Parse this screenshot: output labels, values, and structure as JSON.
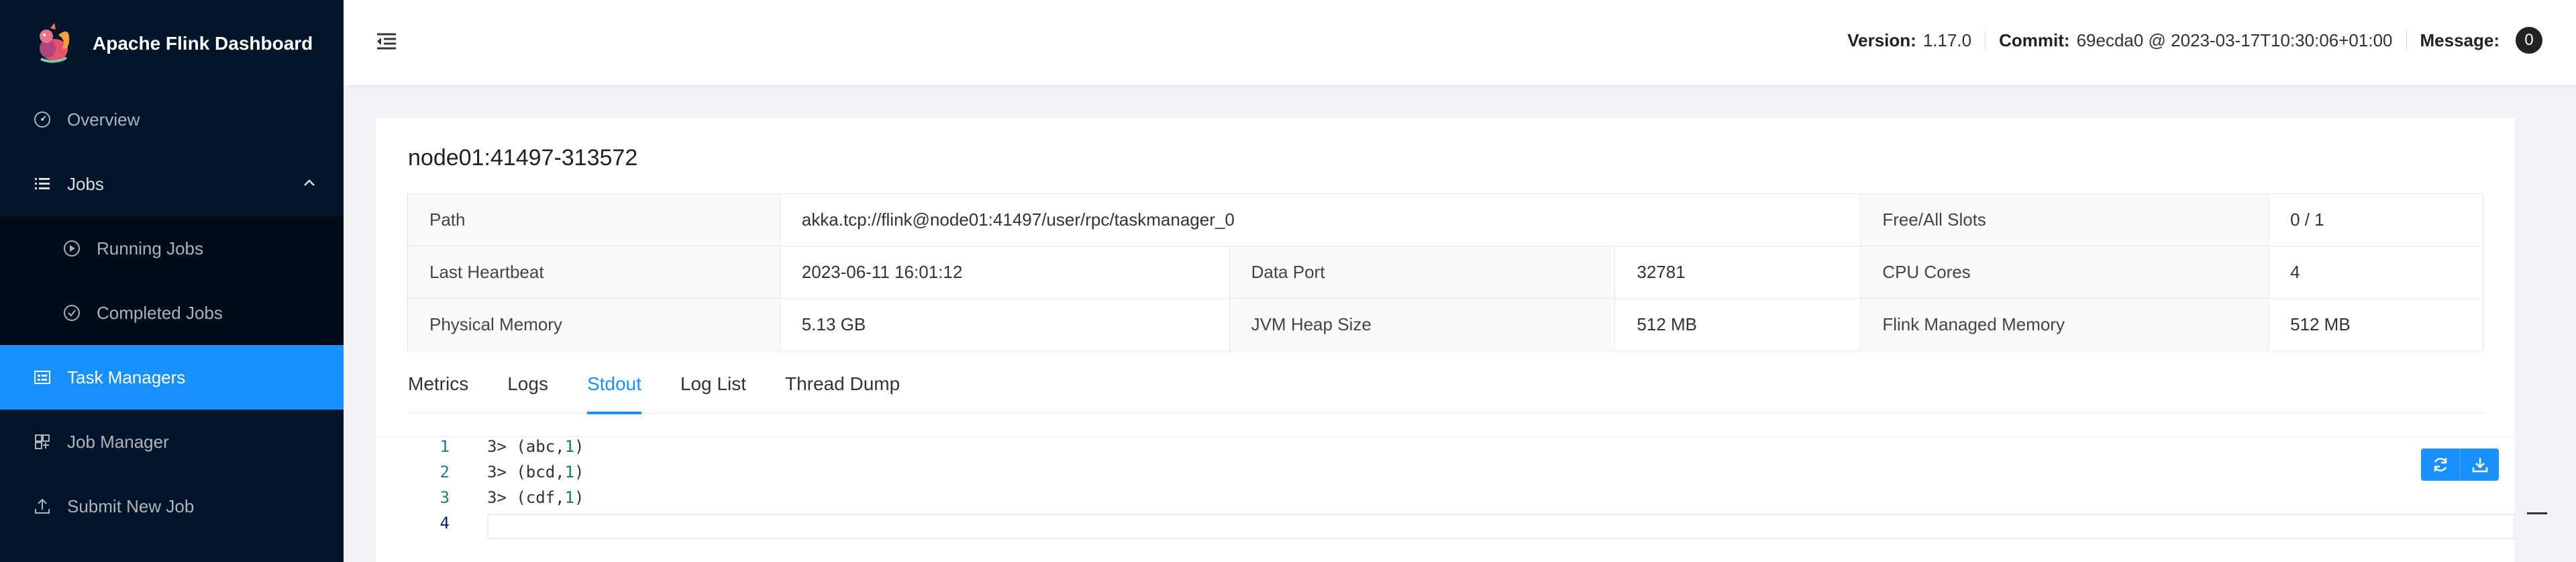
{
  "brand": {
    "title": "Apache Flink Dashboard",
    "icon": "flink-squirrel-logo"
  },
  "sidebar": {
    "items": [
      {
        "label": "Overview",
        "icon": "dashboard-icon"
      },
      {
        "label": "Jobs",
        "icon": "list-icon"
      },
      {
        "label": "Running Jobs",
        "icon": "play-circle-icon"
      },
      {
        "label": "Completed Jobs",
        "icon": "check-circle-icon"
      },
      {
        "label": "Task Managers",
        "icon": "schedule-icon"
      },
      {
        "label": "Job Manager",
        "icon": "build-icon"
      },
      {
        "label": "Submit New Job",
        "icon": "upload-icon"
      }
    ]
  },
  "header": {
    "version_label": "Version:",
    "version": "1.17.0",
    "commit_label": "Commit:",
    "commit": "69ecda0 @ 2023-03-17T10:30:06+01:00",
    "message_label": "Message:",
    "message_count": "0"
  },
  "taskmanager": {
    "title": "node01:41497-313572",
    "path_label": "Path",
    "path": "akka.tcp://flink@node01:41497/user/rpc/taskmanager_0",
    "slots_label": "Free/All Slots",
    "slots": "0 / 1",
    "heartbeat_label": "Last Heartbeat",
    "heartbeat": "2023-06-11 16:01:12",
    "data_port_label": "Data Port",
    "data_port": "32781",
    "cpu_label": "CPU Cores",
    "cpu": "4",
    "phys_mem_label": "Physical Memory",
    "phys_mem": "5.13 GB",
    "jvm_heap_label": "JVM Heap Size",
    "jvm_heap": "512 MB",
    "managed_mem_label": "Flink Managed Memory",
    "managed_mem": "512 MB"
  },
  "tabs": [
    {
      "label": "Metrics"
    },
    {
      "label": "Logs"
    },
    {
      "label": "Stdout",
      "active": true
    },
    {
      "label": "Log List"
    },
    {
      "label": "Thread Dump"
    }
  ],
  "stdout": {
    "lines": [
      {
        "num": "1",
        "prefix": "3> (abc,",
        "value": "1",
        "suffix": ")"
      },
      {
        "num": "2",
        "prefix": "3> (bcd,",
        "value": "1",
        "suffix": ")"
      },
      {
        "num": "3",
        "prefix": "3> (cdf,",
        "value": "1",
        "suffix": ")"
      },
      {
        "num": "4",
        "prefix": "",
        "value": "",
        "suffix": ""
      }
    ]
  },
  "colors": {
    "sidebar_bg": "#001529",
    "accent": "#1890ff",
    "line_number": "#237893",
    "code_number": "#098658"
  }
}
